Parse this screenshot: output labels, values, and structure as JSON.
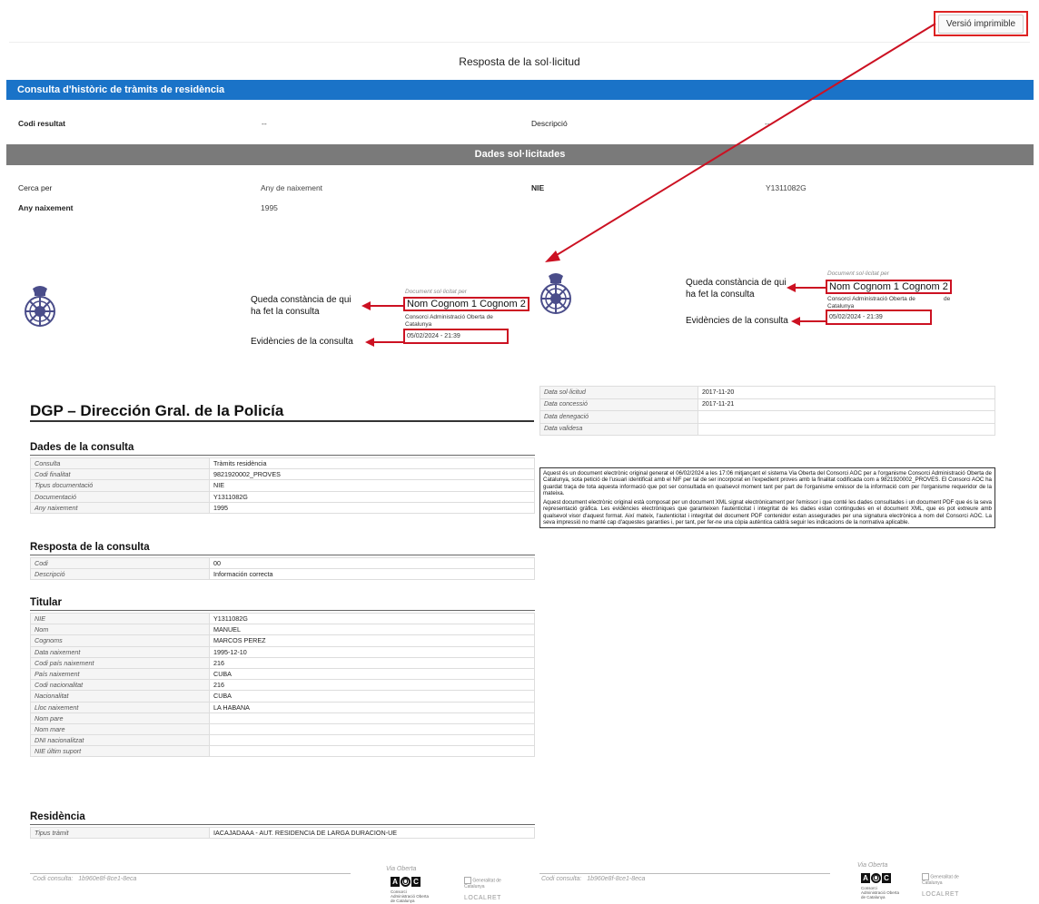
{
  "header": {
    "print_button": "Versió imprimible",
    "page_title": "Resposta de la sol·licitud"
  },
  "query_bar": {
    "title": "Consulta d'històric de tràmits de residència",
    "result_code_label": "Codi resultat",
    "result_code_value": "--",
    "description_label": "Descripció",
    "description_value": "--"
  },
  "requested_data": {
    "title": "Dades sol·licitades",
    "search_by_label": "Cerca per",
    "search_by_value": "Any de naixement",
    "nie_label": "NIE",
    "nie_value": "Y1311082G",
    "birth_year_label": "Any naixement",
    "birth_year_value": "1995"
  },
  "evidence_left": {
    "consulted_by_label": "Queda constància de qui ha fet la consulta",
    "evidence_label": "Evidències de la consulta",
    "doc_header": "Document sol·licitat per",
    "name": "Nom Cognom 1 Cognom 2",
    "org": "Consorci Administració Oberta de Catalunya",
    "datetime": "05/02/2024  -  21:39"
  },
  "evidence_right": {
    "consulted_by_label": "Queda constància de qui ha fet la consulta",
    "evidence_label": "Evidències de la consulta",
    "doc_header": "Document sol·licitat per",
    "name": "Nom Cognom 1 Cognom 2",
    "org": "Consorci Administració Oberta de Catalunya",
    "org_suffix": "de",
    "datetime": "05/02/2024  -  21:39"
  },
  "dgp": {
    "title": "DGP – Dirección Gral. de la Policía",
    "consulta_section": "Dades de la consulta",
    "consulta_rows": [
      {
        "k": "Consulta",
        "v": "Tràmits residència"
      },
      {
        "k": "Codi finalitat",
        "v": "9821920002_PROVES"
      },
      {
        "k": "Tipus documentació",
        "v": "NIE"
      },
      {
        "k": "Documentació",
        "v": "Y1311082G"
      },
      {
        "k": "Any naixement",
        "v": "1995"
      }
    ],
    "resposta_section": "Resposta de la consulta",
    "resposta_rows": [
      {
        "k": "Codi",
        "v": "00"
      },
      {
        "k": "Descripció",
        "v": "Información correcta"
      }
    ],
    "titular_section": "Titular",
    "titular_rows": [
      {
        "k": "NIE",
        "v": "Y1311082G"
      },
      {
        "k": "Nom",
        "v": "MANUEL"
      },
      {
        "k": "Cognoms",
        "v": "MARCOS PEREZ"
      },
      {
        "k": "Data naixement",
        "v": "1995-12-10"
      },
      {
        "k": "Codi país naixement",
        "v": "216"
      },
      {
        "k": "País naixement",
        "v": "CUBA"
      },
      {
        "k": "Codi nacionalitat",
        "v": "216"
      },
      {
        "k": "Nacionalitat",
        "v": "CUBA"
      },
      {
        "k": "Lloc naixement",
        "v": "LA HABANA"
      },
      {
        "k": "Nom pare",
        "v": ""
      },
      {
        "k": "Nom mare",
        "v": ""
      },
      {
        "k": "DNI nacionalitzat",
        "v": ""
      },
      {
        "k": "NIE últim suport",
        "v": ""
      }
    ],
    "residencia_section": "Residència",
    "residencia_rows": [
      {
        "k": "Tipus tràmit",
        "v": "IACAJADAAA - AUT. RESIDENCIA  DE LARGA DURACION-UE"
      }
    ]
  },
  "dates": [
    {
      "k": "Data sol·licitud",
      "v": "2017-11-20"
    },
    {
      "k": "Data concessió",
      "v": "2017-11-21"
    },
    {
      "k": "Data denegació",
      "v": ""
    },
    {
      "k": "Data validesa",
      "v": ""
    }
  ],
  "legal": {
    "p1": "Aquest és un document electrònic original generat el 06/02/2024 a les 17:06 mitjançant el sistema Via Oberta del Consorci AOC per a l'organisme Consorci Administració Oberta de Catalunya, sota petició de l'usuari identificat amb el NIF                per tal de ser incorporat en l'expedient proves amb la finalitat codificada com a 9821920002_PROVES. El Consorci AOC ha guardat traça de tota aquesta informació que pot ser consultada en qualsevol moment tant per part de l'organisme emissor de la informació com per l'organisme requeridor de la mateixa.",
    "p2": "Aquest document electrònic original està composat per un document XML signat electrònicament per l'emissor i que conté les dades consultades i un document PDF que és la seva representació gràfica. Les evidències electròniques que garanteixen l'autenticitat i integritat de les dades estan contingudes en el document XML, que es pot extreure amb qualsevol visor d'aquest format. Així mateix, l'autenticitat i integritat del document PDF contenidor estan assegurades per una signatura electrònica a nom del Consorci AOC. La seva impressió no manté cap d'aquestes garanties i, per tant, per fer-ne una còpia autèntica caldrà seguir les indicacions de la normativa aplicable."
  },
  "footer": {
    "code_label": "Codi consulta:",
    "code_value": "1b960e8f-8ce1-8eca",
    "via_oberta": "Via Oberta",
    "aoc_letters": [
      "A",
      "O",
      "C"
    ],
    "consorci_text": "Consorci Administració Oberta de Catalunya",
    "gencat": "Generalitat de Catalunya",
    "localret": "LOCALRET"
  },
  "colors": {
    "blue_bar": "#1a73c8",
    "gray_bar": "#7a7a7a",
    "annotation_red": "#c12"
  }
}
